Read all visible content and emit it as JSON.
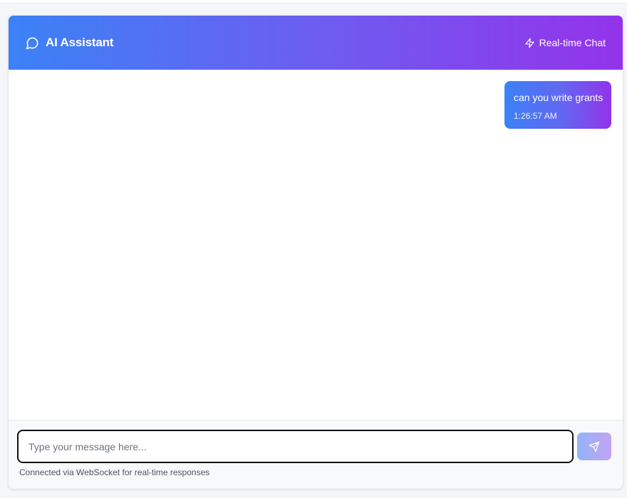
{
  "header": {
    "title": "AI Assistant",
    "title_icon": "message-circle-icon",
    "status_label": "Real-time Chat",
    "status_icon": "lightning-icon",
    "gradient_start": "#3b82f6",
    "gradient_end": "#9333ea"
  },
  "messages": [
    {
      "role": "user",
      "text": "can you write grants",
      "time": "1:26:57 AM"
    }
  ],
  "composer": {
    "placeholder": "Type your message here...",
    "value": "",
    "send_icon": "send-icon",
    "note": "Connected via WebSocket for real-time responses"
  }
}
